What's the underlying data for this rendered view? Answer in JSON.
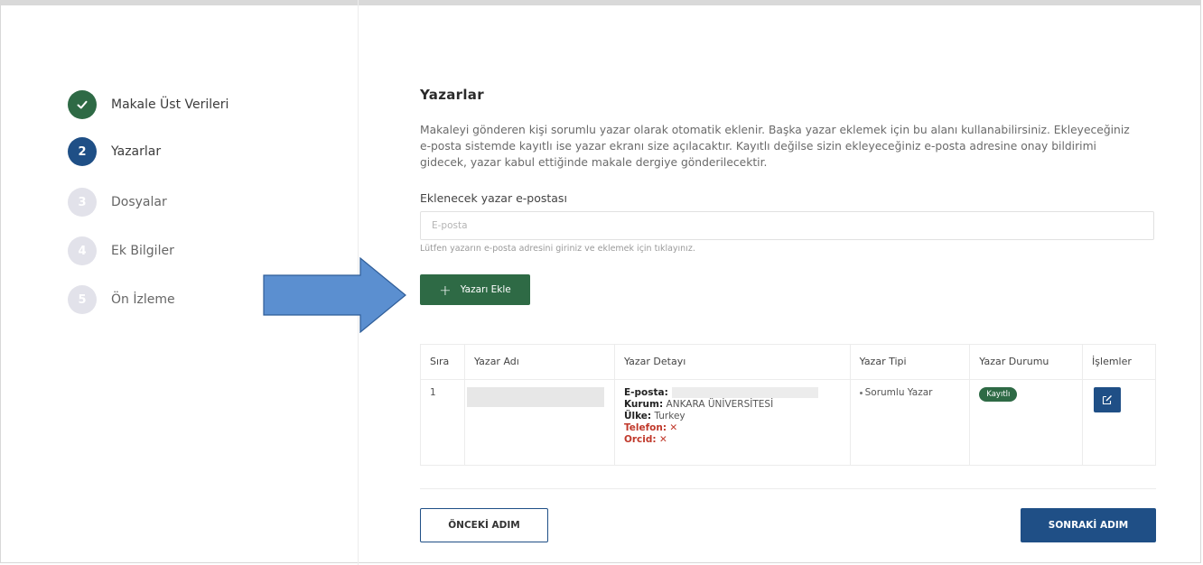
{
  "steps": [
    {
      "number": "",
      "label": "Makale Üst Verileri",
      "state": "done",
      "icon": "check-icon"
    },
    {
      "number": "2",
      "label": "Yazarlar",
      "state": "active"
    },
    {
      "number": "3",
      "label": "Dosyalar",
      "state": "todo"
    },
    {
      "number": "4",
      "label": "Ek Bilgiler",
      "state": "todo"
    },
    {
      "number": "5",
      "label": "Ön İzleme",
      "state": "todo"
    }
  ],
  "page": {
    "title": "Yazarlar",
    "description": "Makaleyi gönderen kişi sorumlu yazar olarak otomatik eklenir. Başka yazar eklemek için bu alanı kullanabilirsiniz. Ekleyeceğiniz e-posta sistemde kayıtlı ise yazar ekranı size açılacaktır. Kayıtlı değilse sizin ekleyeceğiniz e-posta adresine onay bildirimi gidecek, yazar kabul ettiğinde makale dergiye gönderilecektir.",
    "email_label": "Eklenecek yazar e-postası",
    "email_placeholder": "E-posta",
    "email_value": "",
    "hint": "Lütfen yazarın e-posta adresini giriniz ve eklemek için tıklayınız.",
    "add_button": "Yazarı Ekle"
  },
  "table": {
    "headers": [
      "Sıra",
      "Yazar Adı",
      "Yazar Detayı",
      "Yazar Tipi",
      "Yazar Durumu",
      "İşlemler"
    ],
    "rows": [
      {
        "order": "1",
        "email_key": "E-posta:",
        "kurum_key": "Kurum:",
        "kurum_value": "ANKARA ÜNİVERSİTESİ",
        "ulke_key": "Ülke:",
        "ulke_value": "Turkey",
        "telefon_key": "Telefon:",
        "telefon_value": "✕",
        "orcid_key": "Orcid:",
        "orcid_value": "✕",
        "type": "Sorumlu Yazar",
        "status": "Kayıtlı"
      }
    ]
  },
  "footer": {
    "prev": "ÖNCEKİ ADIM",
    "next": "SONRAKİ ADIM"
  },
  "colors": {
    "green": "#2e6a45",
    "blue": "#1f4f86",
    "arrow": "#5b8fd0",
    "pending": "#e2e2ea"
  }
}
